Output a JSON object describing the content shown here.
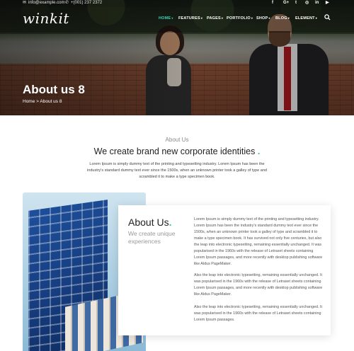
{
  "topbar": {
    "email": "info@example.com",
    "phone": "+(001) 237 2372",
    "social_icons": [
      "facebook-icon",
      "google-plus-icon",
      "twitter-icon",
      "instagram-icon",
      "linkedin-icon",
      "youtube-icon"
    ],
    "social_glyphs": [
      "f",
      "G+",
      "t",
      "◎",
      "in",
      "▶"
    ]
  },
  "nav": {
    "logo": "winkit",
    "items": [
      {
        "label": "HOME",
        "active": true
      },
      {
        "label": "FEATURES",
        "active": false
      },
      {
        "label": "PAGES",
        "active": false
      },
      {
        "label": "PORTFOLIO",
        "active": false
      },
      {
        "label": "SHOP",
        "active": false
      },
      {
        "label": "BLOG",
        "active": false
      },
      {
        "label": "ELEMENT",
        "active": false
      }
    ],
    "caret": "▾",
    "accent_color": "#39d3b8"
  },
  "hero": {
    "title": "About us 8",
    "breadcrumb": "Home > About us 8"
  },
  "intro": {
    "label": "About Us",
    "headline": "We create brand new corporate identities",
    "dot": ".",
    "text": "Lorem Ipsum is simply dummy text of the printing and typesetting industry. Lorem Ipsum has been the industry's standard dummy text ever since the 1500s, when an unknown printer took a galley of type and scrambled it to make a type specimen book."
  },
  "about_card": {
    "title": "About Us",
    "dot": ".",
    "subtitle": "We create unique experiences",
    "paragraphs": [
      "Lorem Ipsum is simply dummy text of the printing and typesetting industry. Lorem Ipsum has been the industry's standard dummy text ever since the 1500s, when an unknown printer took a galley of type and scrambled it to make a type specimen book. It has survived not only five centuries, but also the leap into electronic typesetting, remaining essentially unchanged. It was popularised in the 1960s with the release of Letraset sheets containing Lorem Ipsum passages, and more recently with desktop publishing software like Aldus PageMaker.",
      "Also the leap into electronic typesetting, remaining essentially unchanged. It was popularised in the 1960s with the release of Letraset sheets containing Lorem Ipsum passages, and more recently with desktop publishing software like Aldus PageMaker.",
      "Also the leap into electronic typesetting, remaining essentially unchanged. It was popularised in the 1960s with the release of Letraset sheets containing Lorem Ipsum passages."
    ]
  }
}
